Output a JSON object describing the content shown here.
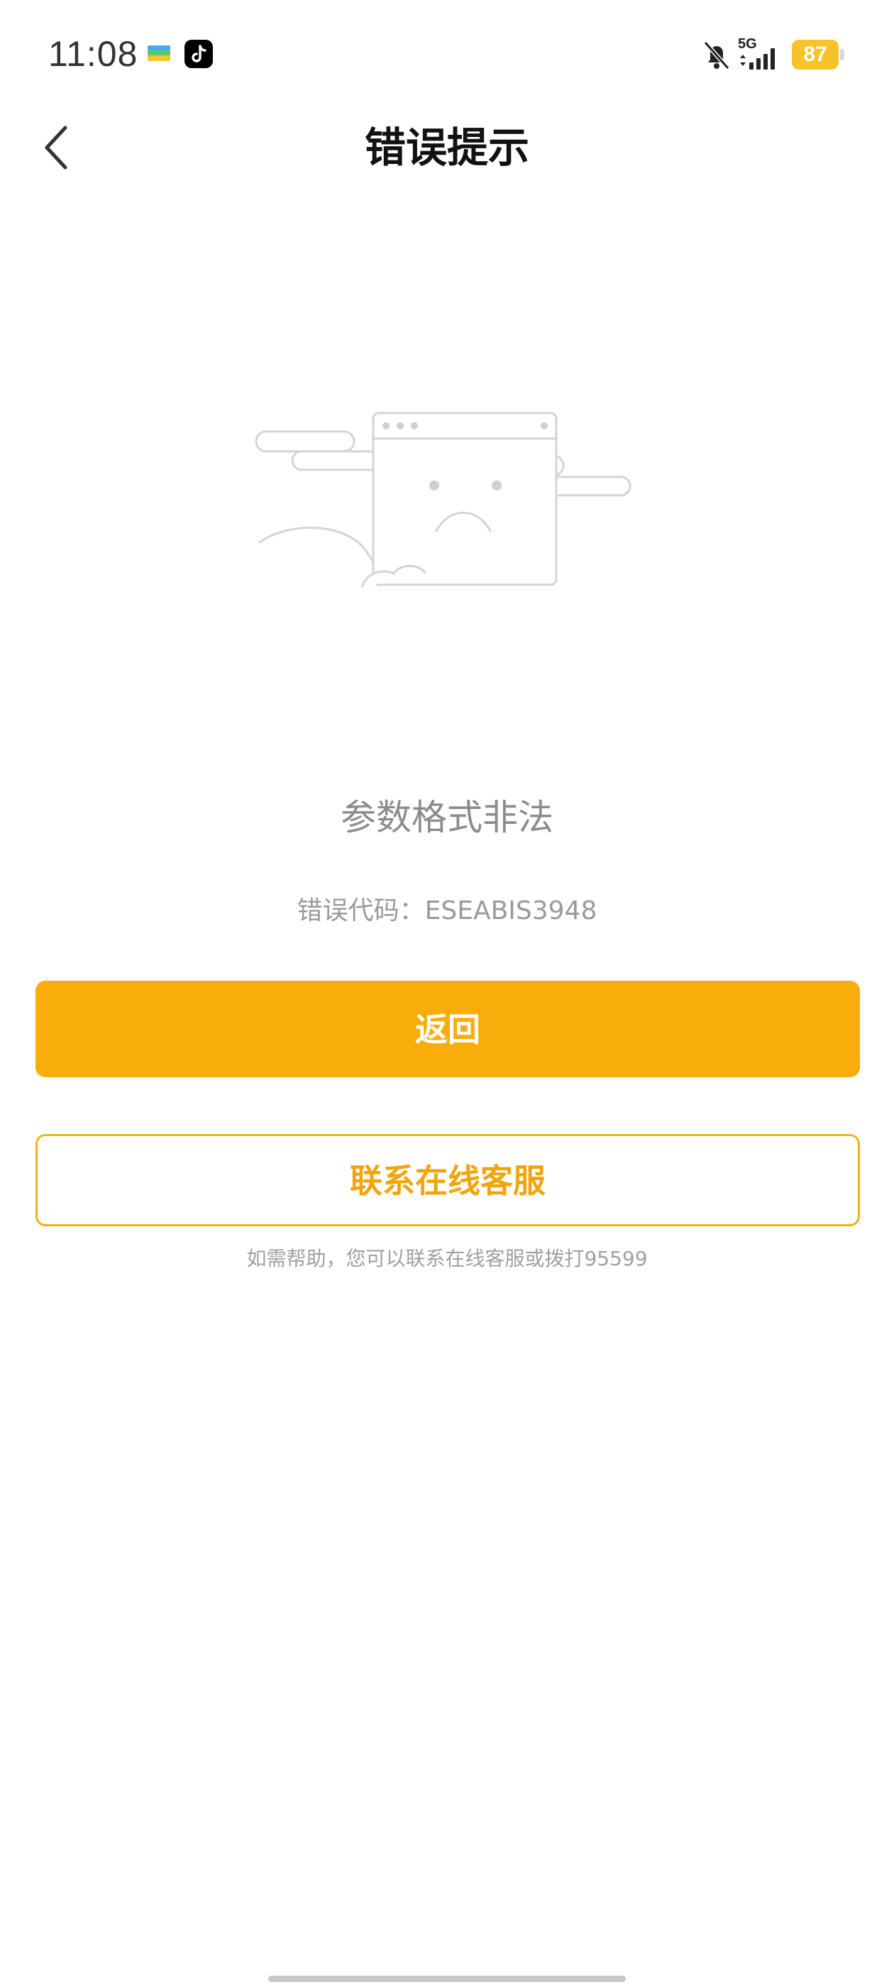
{
  "status_bar": {
    "time": "11:08",
    "network": "5G",
    "battery": "87",
    "icons": [
      "wallet-app-icon",
      "tiktok-app-icon",
      "bell-mute-icon",
      "signal-icon",
      "battery-icon"
    ]
  },
  "nav": {
    "title": "错误提示",
    "back_icon": "chevron-left-icon"
  },
  "content": {
    "illustration": "sad-browser-window-icon",
    "message": "参数格式非法",
    "error_code": "错误代码：ESEABIS3948",
    "primary_button": "返回",
    "secondary_button": "联系在线客服",
    "help_text": "如需帮助，您可以联系在线客服或拨打95599"
  },
  "colors": {
    "accent": "#f8ad0b",
    "accent_border": "#f3b21d",
    "battery": "#f7c22a",
    "muted_text": "#8c8c8c"
  }
}
